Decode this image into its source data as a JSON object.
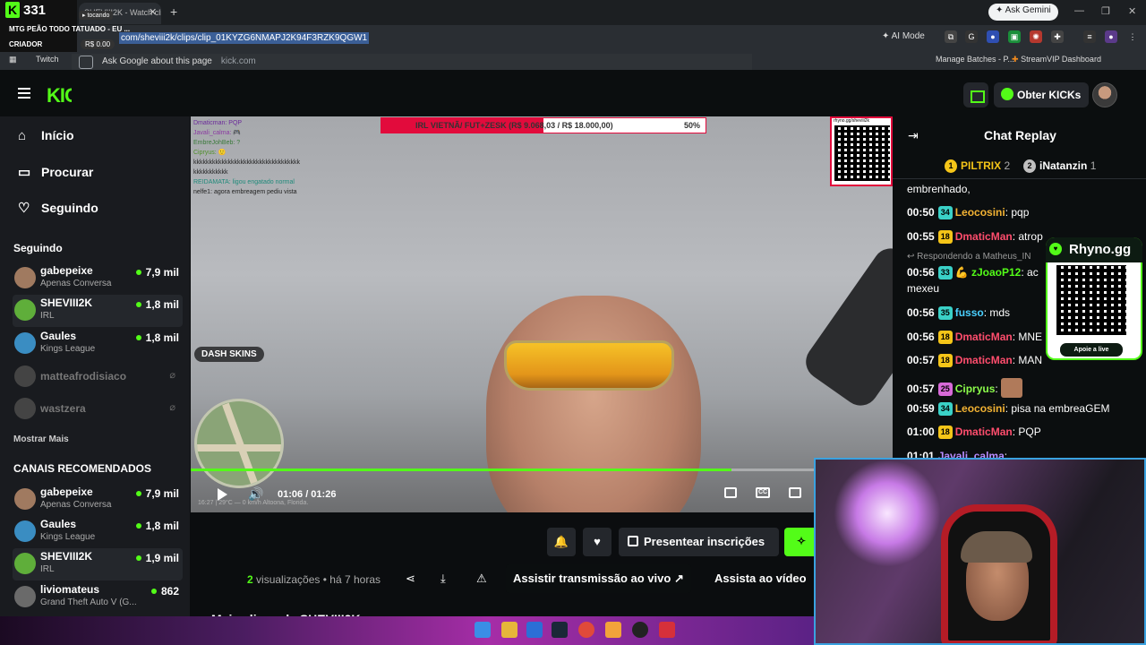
{
  "browser": {
    "tab_title": "SHEVIII2K - Watch clips on Kick",
    "url": "com/sheviii2k/clips/clip_01KYZG6NMAPJ2K94F3RZK9QGW1",
    "ask_gemini": "Ask Gemini",
    "ai_mode": "AI Mode",
    "ask_google": "Ask Google about this page",
    "ask_google_domain": "kick.com",
    "bookmarks": [
      "Twitch",
      "Manage Batches - P...",
      "StreamVIP Dashboard"
    ]
  },
  "overlay": {
    "count": "331",
    "line": "MTG PEÃO TODO TATUADO - EU ...",
    "role": "CRIADOR",
    "money": "R$ 0.00",
    "tocando": "▸ tocando",
    "rhyno_title": "Rhyno.gg",
    "rhyno_cta": "Apoie a live"
  },
  "header": {
    "logo": "KICK",
    "obter": "Obter KICKs"
  },
  "nav": [
    {
      "label": "Início",
      "icon": "home-icon"
    },
    {
      "label": "Procurar",
      "icon": "browse-icon"
    },
    {
      "label": "Seguindo",
      "icon": "heart-icon"
    }
  ],
  "following_title": "Seguindo",
  "following": [
    {
      "name": "gabepeixe",
      "category": "Apenas Conversa",
      "viewers": "7,9 mil",
      "live": true,
      "color": "#a07a60"
    },
    {
      "name": "SHEVIII2K",
      "category": "IRL",
      "viewers": "1,8 mil",
      "live": true,
      "color": "#5fae3a"
    },
    {
      "name": "Gaules",
      "category": "Kings League",
      "viewers": "1,8 mil",
      "live": true,
      "color": "#3a8dc2"
    },
    {
      "name": "matteafrodisiaco",
      "category": "",
      "viewers": "",
      "live": false,
      "color": "#444"
    },
    {
      "name": "wastzera",
      "category": "",
      "viewers": "",
      "live": false,
      "color": "#444"
    }
  ],
  "show_more": "Mostrar Mais",
  "recommended_title": "CANAIS RECOMENDADOS",
  "recommended": [
    {
      "name": "gabepeixe",
      "category": "Apenas Conversa",
      "viewers": "7,9 mil",
      "color": "#a07a60"
    },
    {
      "name": "Gaules",
      "category": "Kings League",
      "viewers": "1,8 mil",
      "color": "#3a8dc2"
    },
    {
      "name": "SHEVIII2K",
      "category": "IRL",
      "viewers": "1,9 mil",
      "color": "#5fae3a"
    },
    {
      "name": "liviomateus",
      "category": "Grand Theft Auto V (G...",
      "viewers": "862",
      "color": "#6a6a6a"
    }
  ],
  "video": {
    "goal_text": "IRL VIETNÃ/ FUT+ZESK (R$ 9.068,03 / R$ 18.000,00)",
    "goal_pct": "50%",
    "goal_fraction": 0.5,
    "qr_url": "rhyno.gg/sheviii2k",
    "dash": "DASH SKINS",
    "time": "01:06 / 01:26",
    "progress": 0.77,
    "location": "16:27 | 29°C — 0 km/h    Altoona, Florida.",
    "chat_overlay": [
      "Dmaticman: PQP",
      "Javali_calma: 🎮",
      "EmbreJohBeb: ?",
      "Cipryus: 🙂",
      "kkkkkkkkkkkkkkkkkkkkkkkkkkkkkkkkkk",
      "kkkkkkkkkkk",
      "REIDAMATA: ligou engatado normal",
      "nelfe1: agora embreagem pediu vista"
    ]
  },
  "actions": {
    "presentear": "Presentear inscrições",
    "views_count": "2",
    "views_label": "visualizações",
    "ago": "• há 7 horas",
    "assistir": "Assistir transmissão ao vivo",
    "assista": "Assista ao vídeo",
    "more_clips": "Mais clipes de SHEVIII2K"
  },
  "chat": {
    "title": "Chat Replay",
    "pinned": [
      {
        "rank": "1",
        "name": "PILTRIX",
        "count": "2",
        "color": "#f5c518"
      },
      {
        "rank": "2",
        "name": "iNatanzin",
        "count": "1",
        "color": "#c0c0c0"
      }
    ],
    "first_line": "embrenhado,",
    "reply_label": "Respondendo a Matheus_IN",
    "messages": [
      {
        "time": "00:50",
        "badge": "34",
        "badge_color": "#3ad1c7",
        "user": "Leocosini",
        "user_color": "#f2b233",
        "text": ": pqp"
      },
      {
        "time": "00:55",
        "badge": "18",
        "badge_color": "#f5c518",
        "user": "DmaticMan",
        "user_color": "#ff4d6d",
        "text": ": atrop"
      },
      {
        "time": "00:56",
        "badge": "33",
        "badge_color": "#3ad1c7",
        "user": "zJoaoP12",
        "user_color": "#53fc18",
        "text": ": ac"
      },
      {
        "time": "",
        "badge": "",
        "badge_color": "",
        "user": "",
        "user_color": "",
        "text": "mexeu"
      },
      {
        "time": "00:56",
        "badge": "35",
        "badge_color": "#3ad1c7",
        "user": "fusso",
        "user_color": "#4ad0ff",
        "text": ": mds"
      },
      {
        "time": "00:56",
        "badge": "18",
        "badge_color": "#f5c518",
        "user": "DmaticMan",
        "user_color": "#ff4d6d",
        "text": ": MNE"
      },
      {
        "time": "00:57",
        "badge": "18",
        "badge_color": "#f5c518",
        "user": "DmaticMan",
        "user_color": "#ff4d6d",
        "text": ": MAN"
      },
      {
        "time": "00:57",
        "badge": "25",
        "badge_color": "#d86ad8",
        "user": "Cipryus",
        "user_color": "#8cfc4b",
        "text": ":"
      },
      {
        "time": "00:59",
        "badge": "34",
        "badge_color": "#3ad1c7",
        "user": "Leocosini",
        "user_color": "#f2b233",
        "text": ": pisa na embreaGEM"
      },
      {
        "time": "01:00",
        "badge": "18",
        "badge_color": "#f5c518",
        "user": "DmaticMan",
        "user_color": "#ff4d6d",
        "text": ": PQP"
      },
      {
        "time": "01:01",
        "badge": "",
        "badge_color": "",
        "user": "Javali_calma",
        "user_color": "#b98cff",
        "text": ":"
      }
    ]
  }
}
